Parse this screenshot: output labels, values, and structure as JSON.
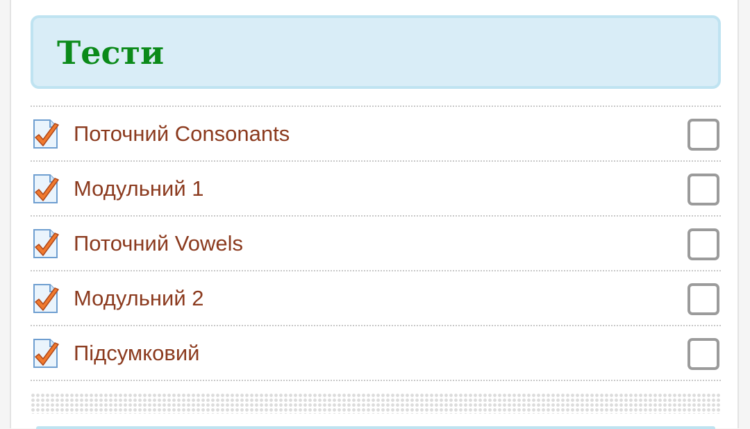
{
  "section": {
    "title": "Тести"
  },
  "activities": [
    {
      "label": "Поточний Consonants",
      "icon": "quiz-icon",
      "completed": false
    },
    {
      "label": "Модульний 1",
      "icon": "quiz-icon",
      "completed": false
    },
    {
      "label": "Поточний Vowels",
      "icon": "quiz-icon",
      "completed": false
    },
    {
      "label": "Модульний 2",
      "icon": "quiz-icon",
      "completed": false
    },
    {
      "label": "Підсумковий",
      "icon": "quiz-icon",
      "completed": false
    }
  ],
  "colors": {
    "title": "#0b8a1a",
    "header_bg": "#d9edf7",
    "header_border": "#bfe3f1",
    "link": "#8b3a1e",
    "checkbox_border": "#9b9b9b",
    "icon_check": "#f07a2e"
  }
}
